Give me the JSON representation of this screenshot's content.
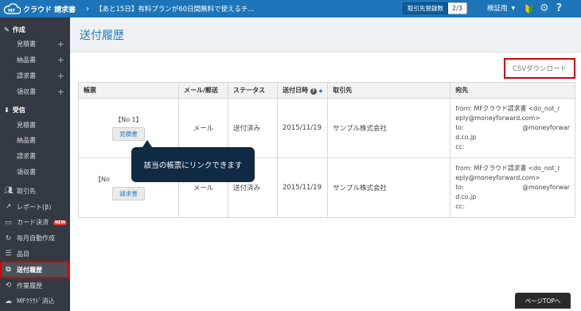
{
  "topbar": {
    "logo_text": "クラウド 請求書",
    "logo_mark": "MF",
    "notice": "【あと15日】有料プランが60日間無料で使えるチ...",
    "registered_label": "取引先登録数",
    "registered_count": "2/3",
    "user_name": "検証用",
    "user_caret": "▼",
    "chevron": "›"
  },
  "sidebar": {
    "create_label": "作成",
    "create_items": [
      {
        "label": "見積書",
        "plus": "+"
      },
      {
        "label": "納品書",
        "plus": "+"
      },
      {
        "label": "請求書",
        "plus": "+"
      },
      {
        "label": "領収書",
        "plus": "+"
      }
    ],
    "receive_label": "受信",
    "receive_items": [
      "見積書",
      "納品書",
      "請求書",
      "領収書"
    ],
    "nav": [
      {
        "label": "取引先",
        "icon": "people-icon"
      },
      {
        "label": "レポート(β)",
        "icon": "chart-icon"
      },
      {
        "label": "カード決済",
        "icon": "card-icon",
        "badge": "NEW"
      },
      {
        "label": "毎月自動作成",
        "icon": "refresh-icon"
      },
      {
        "label": "品目",
        "icon": "list-icon"
      },
      {
        "label": "送付履歴",
        "icon": "send-history-icon",
        "active": true
      },
      {
        "label": "作業履歴",
        "icon": "history-icon"
      },
      {
        "label": "MFｸﾗｳﾄﾞ消込",
        "icon": "cloud-icon"
      }
    ]
  },
  "main": {
    "title": "送付履歴",
    "csv_label": "CSVダウンロード",
    "columns": [
      "帳票",
      "メール/郵送",
      "ステータス",
      "送付日時",
      "取引先",
      "宛先"
    ],
    "sort_glyph": "◆",
    "help_glyph": "?",
    "rows": [
      {
        "no": "【No 1】",
        "doc_button": "見積書",
        "method": "メール",
        "status": "送付済み",
        "date": "2015/11/19",
        "partner": "サンプル株式会社",
        "from_line1": "from: MFクラウド請求書 <do_not_r",
        "from_line2": "eply@moneyforward.com>",
        "to_label": "to:",
        "to_value": "@moneyforwar",
        "to_line2": "d.co.jp",
        "cc": "cc:"
      },
      {
        "no": "【No",
        "doc_button": "請求書",
        "method": "メール",
        "status": "送付済み",
        "date": "2015/11/19",
        "partner": "サンプル株式会社",
        "from_line1": "from: MFクラウド請求書 <do_not_r",
        "from_line2": "eply@moneyforward.com>",
        "to_label": "to:",
        "to_value": "@moneyforwar",
        "to_line2": "d.co.jp",
        "cc": "cc:"
      }
    ],
    "tooltip": "該当の帳票にリンクできます"
  },
  "page_top": "ページTOPへ",
  "colors": {
    "topbar": "#1d74b8",
    "sidebar": "#333a41",
    "highlight": "#d10000",
    "title": "#2a78b8",
    "tooltip": "#102a43"
  }
}
